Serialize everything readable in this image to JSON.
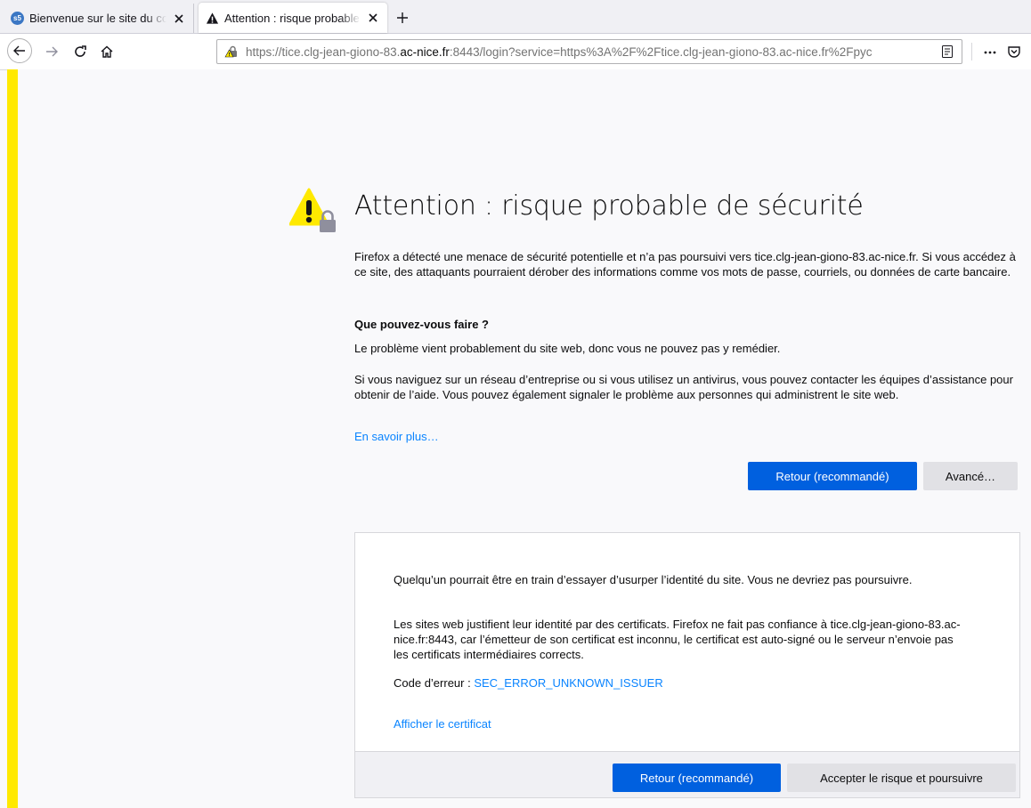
{
  "tabs": [
    {
      "label": "Bienvenue sur le site du collège",
      "favicon": "s5-logo-icon",
      "favicon_text": "s5"
    },
    {
      "label": "Attention : risque probable de sécurité",
      "favicon": "warning-icon",
      "active": true
    }
  ],
  "nav": {
    "url_prefix": "https://tice.clg-jean-giono-83.",
    "url_host": "ac-nice.fr",
    "url_suffix": ":8443/login?service=https%3A%2F%2Ftice.clg-jean-giono-83.ac-nice.fr%2Fpyc",
    "icons": [
      "back-icon",
      "forward-icon",
      "reload-icon",
      "home-icon",
      "insecure-lock-icon",
      "reader-view-icon",
      "more-icon",
      "pocket-icon"
    ]
  },
  "page": {
    "title": "Attention : risque probable de sécurité",
    "intro": "Firefox a détecté une menace de sécurité potentielle et n’a pas poursuivi vers tice.clg-jean-giono-83.ac-nice.fr. Si vous accédez à ce site, des attaquants pourraient dérober des informations comme vos mots de passe, courriels, ou données de carte bancaire.",
    "what_heading": "Que pouvez-vous faire ?",
    "what_1": "Le problème vient probablement du site web, donc vous ne pouvez pas y remédier.",
    "what_2": "Si vous naviguez sur un réseau d’entreprise ou si vous utilisez un antivirus, vous pouvez contacter les équipes d’assistance pour obtenir de l’aide. Vous pouvez également signaler le problème aux personnes qui administrent le site web.",
    "learn_more": "En savoir plus…",
    "back_button": "Retour (recommandé)",
    "advanced_button": "Avancé…"
  },
  "advanced": {
    "p1": "Quelqu’un pourrait être en train d’essayer d’usurper l’identité du site. Vous ne devriez pas poursuivre.",
    "p2": "Les sites web justifient leur identité par des certificats. Firefox ne fait pas confiance à tice.clg-jean-giono-83.ac-nice.fr:8443, car l’émetteur de son certificat est inconnu, le certificat est auto-signé ou le serveur n’envoie pas les certificats intermédiaires corrects.",
    "error_label": "Code d’erreur : ",
    "error_code": "SEC_ERROR_UNKNOWN_ISSUER",
    "view_cert": "Afficher le certificat",
    "back_button": "Retour (recommandé)",
    "accept_button": "Accepter le risque et poursuivre"
  },
  "colors": {
    "accent_blue": "#0060df",
    "link_blue": "#0a84ff",
    "warning_yellow": "#ffe900"
  }
}
